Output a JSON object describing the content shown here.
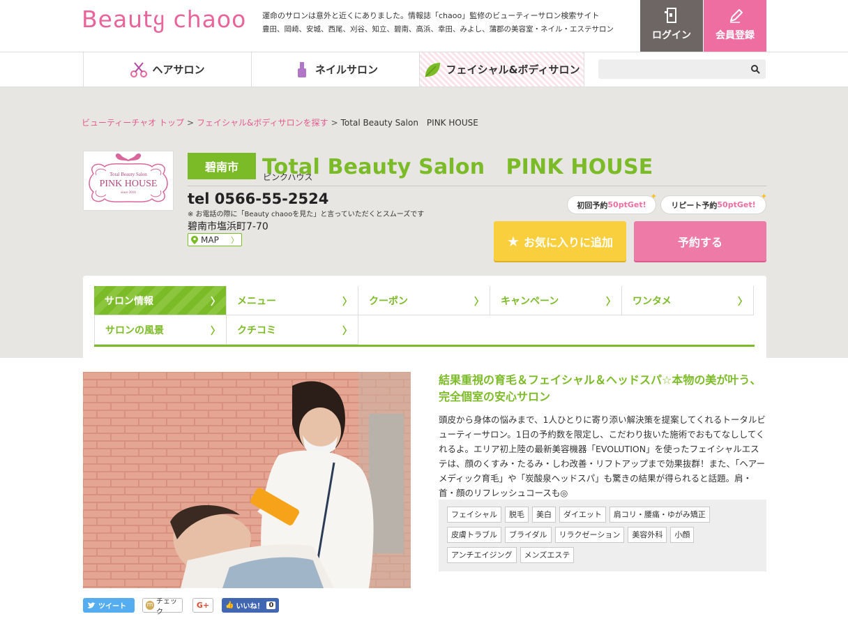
{
  "header": {
    "logo_text_1": "Beaut",
    "logo_text_2": "chaoo",
    "tagline_1": "運命のサロンは意外と近くにありました。情報誌「chaoo」監修のビューティーサロン検索サイト",
    "tagline_2": "豊田、岡崎、安城、西尾、刈谷、知立、碧南、高浜、幸田、みよし、蒲郡の美容室・ネイル・エステサロン",
    "login_label": "ログイン",
    "signup_label": "会員登録"
  },
  "catnav": {
    "items": [
      {
        "label": "ヘアサロン",
        "icon": "scissors-icon"
      },
      {
        "label": "ネイルサロン",
        "icon": "nail-polish-icon"
      },
      {
        "label": "フェイシャル&ボディサロン",
        "icon": "leaf-icon"
      }
    ],
    "search_placeholder": ""
  },
  "breadcrumb": {
    "items": [
      "ビューティーチャオ トップ",
      "フェイシャル&ボディサロンを探す",
      "Total Beauty Salon　PINK HOUSE"
    ],
    "separator": ">"
  },
  "salon": {
    "logo_line1": "Total Beauty Salon",
    "logo_line2": "PINK HOUSE",
    "logo_line3": "since 2018",
    "city": "碧南市",
    "name": "Total Beauty Salon　PINK HOUSE",
    "kana": "ピンクハウス",
    "tel": "tel 0566-55-2524",
    "tel_note": "※ お電話の際に「Beauty chaooを見た」と言っていただくとスムーズです",
    "address": "碧南市塩浜町7-70",
    "map_label": "MAP",
    "first_badge_pre": "初回予約",
    "first_badge_pt": "50ptGet!",
    "repeat_badge_pre": "リピート予約",
    "repeat_badge_pt": "50ptGet!",
    "favorite_label": "お気に入りに追加",
    "reserve_label": "予約する"
  },
  "tabs": [
    {
      "label": "サロン情報",
      "active": true
    },
    {
      "label": "メニュー"
    },
    {
      "label": "クーポン"
    },
    {
      "label": "キャンペーン"
    },
    {
      "label": "ワンタメ"
    },
    {
      "label": "サロンの風景"
    },
    {
      "label": "クチコミ"
    }
  ],
  "main": {
    "headline": "結果重視の育毛＆フェイシャル＆ヘッドスパ☆本物の美が叶う、完全個室の安心サロン",
    "description": "頭皮から身体の悩みまで、1人ひとりに寄り添い解決策を提案してくれるトータルビューティーサロン。1日の予約数を限定し、こだわり抜いた施術でおもてなししてくれるよ。エリア初上陸の最新美容機器「EVOLUTION」を使ったフェイシャルエステは、顔のくすみ・たるみ・しわ改善・リフトアップまで効果抜群！また、「ヘアーメディック育毛」や「炭酸泉ヘッドスパ」も驚きの結果が得られると話題。肩・首・顔のリフレッシュコースも◎",
    "tags": [
      "フェイシャル",
      "脱毛",
      "美白",
      "ダイエット",
      "肩コリ・腰痛・ゆがみ矯正",
      "皮膚トラブル",
      "ブライダル",
      "リラクゼーション",
      "美容外科",
      "小顔",
      "アンチエイジング",
      "メンズエステ"
    ]
  },
  "social": {
    "tweet": "ツイート",
    "mixi": "チェック",
    "gplus": "G+",
    "like": "いいね！",
    "like_count": "0"
  },
  "colors": {
    "brand_pink": "#ee6ea2",
    "brand_green": "#7cbb28",
    "favorite_yellow": "#f9cf3e",
    "login_gray": "#6d6664"
  }
}
